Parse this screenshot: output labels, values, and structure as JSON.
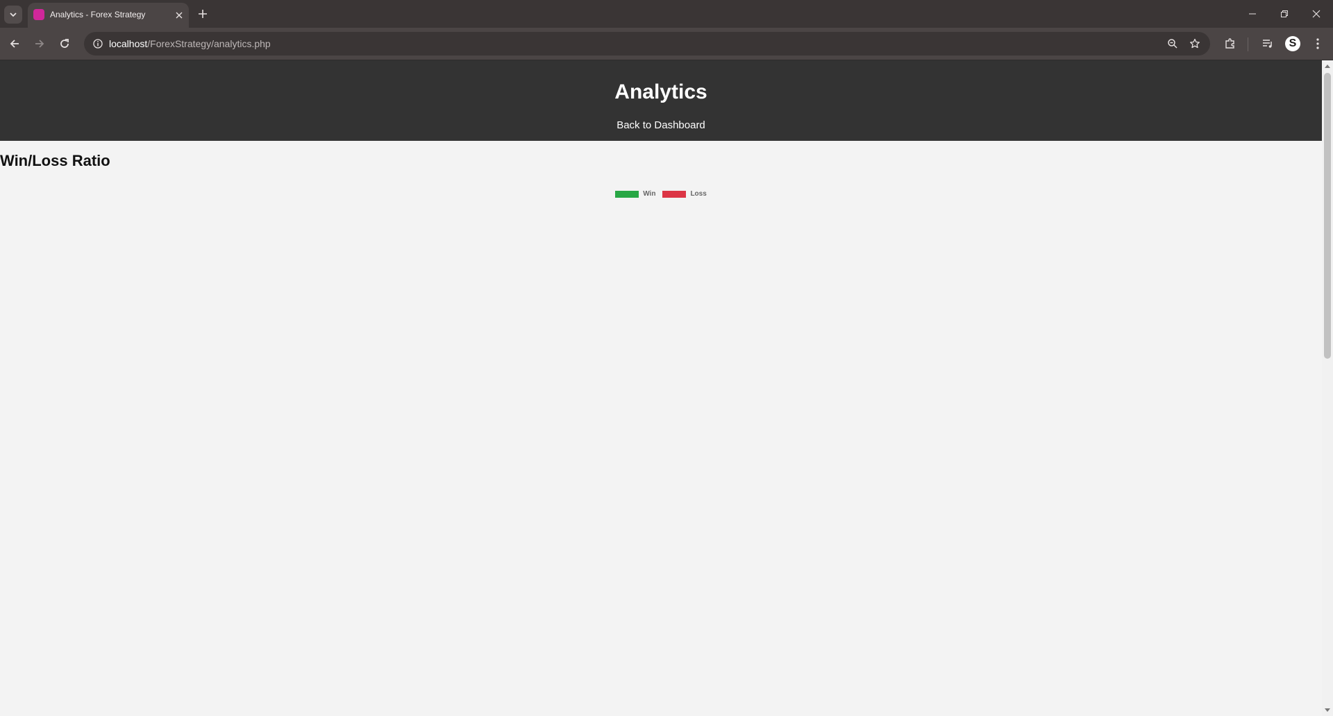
{
  "browser": {
    "tab": {
      "title": "Analytics - Forex Strategy",
      "favicon": "page-favicon"
    },
    "url": {
      "host": "localhost",
      "path": "/ForexStrategy/analytics.php"
    },
    "profile_initial": "S",
    "icons": {
      "tab_search": "chevron-down-icon",
      "tab_close": "close-icon",
      "new_tab": "plus-icon",
      "minimize": "minimize-icon",
      "restore": "restore-icon",
      "close_window": "close-icon",
      "back": "back-arrow-icon",
      "forward": "forward-arrow-icon",
      "reload": "reload-icon",
      "site_info": "info-icon",
      "zoom": "zoom-icon",
      "bookmark": "star-icon",
      "extensions": "puzzle-icon",
      "media": "media-queue-icon",
      "menu": "kebab-menu-icon"
    }
  },
  "page": {
    "header": {
      "title": "Analytics",
      "back_link": "Back to Dashboard"
    },
    "section_title": "Win/Loss Ratio"
  },
  "chart_data": {
    "type": "bar",
    "title": "",
    "legend_position": "top-center",
    "series": [
      {
        "name": "Win",
        "color": "#28a745",
        "values": []
      },
      {
        "name": "Loss",
        "color": "#dc3545",
        "values": []
      }
    ],
    "categories": []
  }
}
